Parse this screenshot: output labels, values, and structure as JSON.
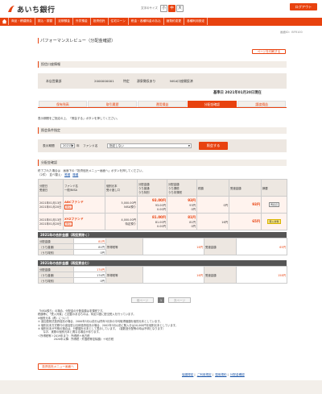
{
  "header": {
    "bank_name": "あいち銀行",
    "font_size_label": "文字のサイズ",
    "font_sizes": [
      "小",
      "中",
      "大"
    ],
    "logout": "ログアウト",
    "brand_color": "#e8420f"
  },
  "nav": [
    "商品・積建照会",
    "振込・振替",
    "定期預金",
    "外貨預金",
    "投資信託",
    "住宅ローン",
    "税金・各種料金の払込",
    "諸契約変更",
    "各種利用設定"
  ],
  "screen_id": "画面ID：BFR100",
  "page_title": "パフォーマンスレビュー（分配金確認）",
  "print_button": "ページを印刷する",
  "account_section": {
    "heading": "投信口座情報",
    "branch": "本店営業部",
    "account_no": "2000000001",
    "type": "特定",
    "holder": "源泉徴収あり",
    "nisa": "NISA口座開設済"
  },
  "base_date": "基準日 2021年01月20日現在",
  "tabs": [
    {
      "label": "保有残高",
      "active": false
    },
    {
      "label": "取引履歴",
      "active": false
    },
    {
      "label": "運用損益",
      "active": false
    },
    {
      "label": "分配金確認",
      "active": true
    },
    {
      "label": "譲渡損益",
      "active": false
    }
  ],
  "instruction": "表示期間をご指定の上、「照会する」ボタンを押してください。",
  "condition_section": {
    "heading": "照会条件指定",
    "period_label": "表示期間",
    "year_value": "2021年",
    "year_suffix": "年",
    "fund_label": "ファンド名",
    "fund_value": "指定しない",
    "submit": "照会する"
  },
  "dist_section": {
    "heading": "分配金確認",
    "note1": "終了された場合は　画面下の「投資信託メニュー画面へ」ボタンを押してください。",
    "note2_prefix": "（2件）　並べ替え：",
    "sort_links": [
      "昇順",
      "降順"
    ],
    "headers": [
      "分配日\n受渡日",
      "ファンド名\n一般/NISA",
      "個別元本\n受け渡し口",
      "分配金額\nうち普通\nうち特別",
      "分配金額\nうち課税\nうち非課税",
      "税額",
      "受渡金額",
      "摘要"
    ],
    "rows": [
      {
        "date1": "2021年01月13日",
        "date2": "2021年01月20日",
        "fund": "ABCファンド",
        "badge": "累投",
        "principal": "5,000.00円",
        "account_type": "NISA預り",
        "dist": "93.00円",
        "dist_normal": "93.00円",
        "dist_special": "0.00円",
        "tax_base": "93円",
        "taxable": "93円",
        "nontax": "0円",
        "tax": "0円",
        "delivery": "93円",
        "memo": "再投資"
      },
      {
        "date1": "2021年01月13日",
        "date2": "2021年01月20日",
        "fund": "XYZファンド",
        "badge": "累投",
        "principal": "4,000.00円",
        "account_type": "特定預り",
        "dist": "81.00円",
        "dist_normal": "81.00円",
        "dist_special": "0.00円",
        "tax_base": "81円",
        "taxable": "81円",
        "nontax": "0円",
        "tax": "16円",
        "delivery": "65円",
        "memo": "受入対象"
      }
    ]
  },
  "total_excl": {
    "heading": "2021年の合計金額（再投資除く）",
    "dist_label": "分配金額",
    "dist": "81円",
    "normal_label": "（うち普通）",
    "normal": "81円",
    "special_label": "（うち特別）",
    "special": "0円",
    "tax_label": "所得税等",
    "tax": "16円",
    "delivery_label": "受渡金額",
    "delivery": "65円"
  },
  "total_incl": {
    "heading": "2021年の合計金額（再投資含む）",
    "dist_label": "分配金額",
    "dist": "174円",
    "normal_label": "（うち普通）",
    "normal": "174円",
    "special_label": "（うち特別）",
    "special": "0円",
    "tax_label": "所得税等",
    "tax": "16円",
    "delivery_label": "受渡金額",
    "delivery": "158円"
  },
  "pager": {
    "prev": "前ページ",
    "current": "1",
    "next": "次ページ"
  },
  "notes": [
    "「NISA預り」の場合、分配金の分配金額は非課税です。",
    "税額等に「受入対象」と記載のあるものは、特定口座に配当受入を行っています。",
    "※個別元本（再）について",
    "① 追加型株式投資信託の場合、2000年3月以前分は同年3月末の平均取得価額を個別元本としています。",
    "② 個別元本方式移行の追加型公社債投資信託の場合、2002年3月以前に購入分は10,000円を個別元本としています。",
    "③ 個別元本が不明の場合は、分配額を元本として表示しています。（複数回分配等の時は不明となります）",
    "　　なお、実際の個別元本と異なる場合があります。",
    "＜所得税等＞2019年まで：所得税＋地方税",
    "　　　　　　2020年以降：所得税・外国税等控除額）＋地方税"
  ],
  "back_button": "投資信託メニュー画面へ",
  "footer_links": [
    "保護規定",
    "ご利用規定",
    "運用規約",
    "分配金確認"
  ]
}
